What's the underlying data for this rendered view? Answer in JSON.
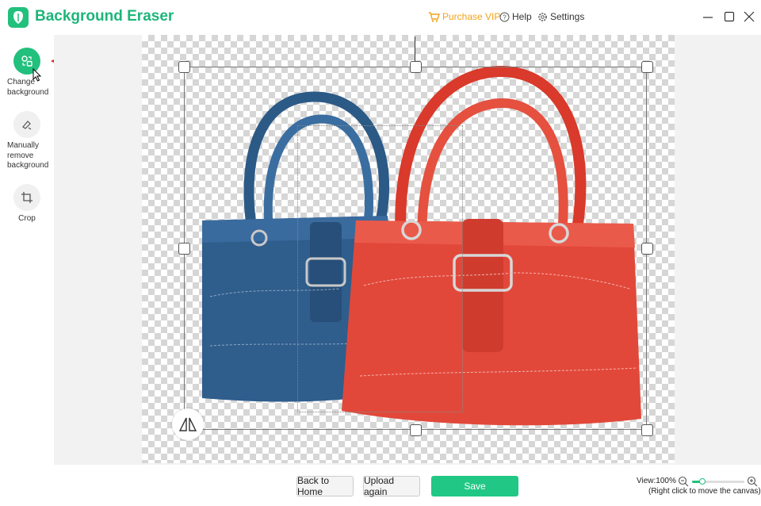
{
  "app": {
    "title": "Background Eraser"
  },
  "header": {
    "purchase": "Purchase VIP",
    "help": "Help",
    "settings": "Settings"
  },
  "sidebar": {
    "tools": [
      {
        "label": "Change background",
        "icon": "change-background-icon",
        "active": true
      },
      {
        "label": "Manually remove background",
        "icon": "brush-icon",
        "active": false
      },
      {
        "label": "Crop",
        "icon": "crop-icon",
        "active": false
      }
    ]
  },
  "bottom": {
    "back_home": "Back to Home",
    "upload_again": "Upload again",
    "save": "Save",
    "view_label": "View:100%",
    "hint": "(Right click to move the canvas)",
    "zoom_fraction": 0.2
  },
  "colors": {
    "accent": "#21c07c",
    "vip": "#f2a31b",
    "annotation_arrow": "#e02020",
    "blue_bag": "#2f5d8c",
    "red_bag": "#e1483a"
  }
}
